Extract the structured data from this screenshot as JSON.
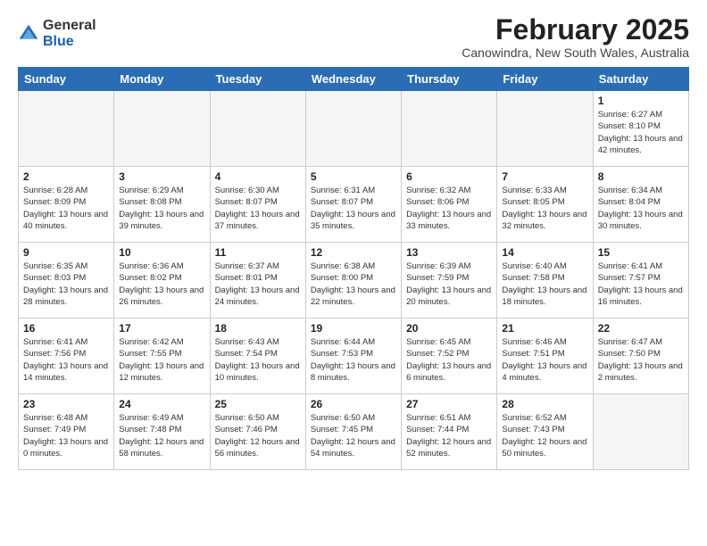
{
  "logo": {
    "general": "General",
    "blue": "Blue"
  },
  "title": "February 2025",
  "location": "Canowindra, New South Wales, Australia",
  "headers": [
    "Sunday",
    "Monday",
    "Tuesday",
    "Wednesday",
    "Thursday",
    "Friday",
    "Saturday"
  ],
  "weeks": [
    [
      {
        "day": "",
        "info": ""
      },
      {
        "day": "",
        "info": ""
      },
      {
        "day": "",
        "info": ""
      },
      {
        "day": "",
        "info": ""
      },
      {
        "day": "",
        "info": ""
      },
      {
        "day": "",
        "info": ""
      },
      {
        "day": "1",
        "info": "Sunrise: 6:27 AM\nSunset: 8:10 PM\nDaylight: 13 hours\nand 42 minutes."
      }
    ],
    [
      {
        "day": "2",
        "info": "Sunrise: 6:28 AM\nSunset: 8:09 PM\nDaylight: 13 hours\nand 40 minutes."
      },
      {
        "day": "3",
        "info": "Sunrise: 6:29 AM\nSunset: 8:08 PM\nDaylight: 13 hours\nand 39 minutes."
      },
      {
        "day": "4",
        "info": "Sunrise: 6:30 AM\nSunset: 8:07 PM\nDaylight: 13 hours\nand 37 minutes."
      },
      {
        "day": "5",
        "info": "Sunrise: 6:31 AM\nSunset: 8:07 PM\nDaylight: 13 hours\nand 35 minutes."
      },
      {
        "day": "6",
        "info": "Sunrise: 6:32 AM\nSunset: 8:06 PM\nDaylight: 13 hours\nand 33 minutes."
      },
      {
        "day": "7",
        "info": "Sunrise: 6:33 AM\nSunset: 8:05 PM\nDaylight: 13 hours\nand 32 minutes."
      },
      {
        "day": "8",
        "info": "Sunrise: 6:34 AM\nSunset: 8:04 PM\nDaylight: 13 hours\nand 30 minutes."
      }
    ],
    [
      {
        "day": "9",
        "info": "Sunrise: 6:35 AM\nSunset: 8:03 PM\nDaylight: 13 hours\nand 28 minutes."
      },
      {
        "day": "10",
        "info": "Sunrise: 6:36 AM\nSunset: 8:02 PM\nDaylight: 13 hours\nand 26 minutes."
      },
      {
        "day": "11",
        "info": "Sunrise: 6:37 AM\nSunset: 8:01 PM\nDaylight: 13 hours\nand 24 minutes."
      },
      {
        "day": "12",
        "info": "Sunrise: 6:38 AM\nSunset: 8:00 PM\nDaylight: 13 hours\nand 22 minutes."
      },
      {
        "day": "13",
        "info": "Sunrise: 6:39 AM\nSunset: 7:59 PM\nDaylight: 13 hours\nand 20 minutes."
      },
      {
        "day": "14",
        "info": "Sunrise: 6:40 AM\nSunset: 7:58 PM\nDaylight: 13 hours\nand 18 minutes."
      },
      {
        "day": "15",
        "info": "Sunrise: 6:41 AM\nSunset: 7:57 PM\nDaylight: 13 hours\nand 16 minutes."
      }
    ],
    [
      {
        "day": "16",
        "info": "Sunrise: 6:41 AM\nSunset: 7:56 PM\nDaylight: 13 hours\nand 14 minutes."
      },
      {
        "day": "17",
        "info": "Sunrise: 6:42 AM\nSunset: 7:55 PM\nDaylight: 13 hours\nand 12 minutes."
      },
      {
        "day": "18",
        "info": "Sunrise: 6:43 AM\nSunset: 7:54 PM\nDaylight: 13 hours\nand 10 minutes."
      },
      {
        "day": "19",
        "info": "Sunrise: 6:44 AM\nSunset: 7:53 PM\nDaylight: 13 hours\nand 8 minutes."
      },
      {
        "day": "20",
        "info": "Sunrise: 6:45 AM\nSunset: 7:52 PM\nDaylight: 13 hours\nand 6 minutes."
      },
      {
        "day": "21",
        "info": "Sunrise: 6:46 AM\nSunset: 7:51 PM\nDaylight: 13 hours\nand 4 minutes."
      },
      {
        "day": "22",
        "info": "Sunrise: 6:47 AM\nSunset: 7:50 PM\nDaylight: 13 hours\nand 2 minutes."
      }
    ],
    [
      {
        "day": "23",
        "info": "Sunrise: 6:48 AM\nSunset: 7:49 PM\nDaylight: 13 hours\nand 0 minutes."
      },
      {
        "day": "24",
        "info": "Sunrise: 6:49 AM\nSunset: 7:48 PM\nDaylight: 12 hours\nand 58 minutes."
      },
      {
        "day": "25",
        "info": "Sunrise: 6:50 AM\nSunset: 7:46 PM\nDaylight: 12 hours\nand 56 minutes."
      },
      {
        "day": "26",
        "info": "Sunrise: 6:50 AM\nSunset: 7:45 PM\nDaylight: 12 hours\nand 54 minutes."
      },
      {
        "day": "27",
        "info": "Sunrise: 6:51 AM\nSunset: 7:44 PM\nDaylight: 12 hours\nand 52 minutes."
      },
      {
        "day": "28",
        "info": "Sunrise: 6:52 AM\nSunset: 7:43 PM\nDaylight: 12 hours\nand 50 minutes."
      },
      {
        "day": "",
        "info": ""
      }
    ]
  ]
}
